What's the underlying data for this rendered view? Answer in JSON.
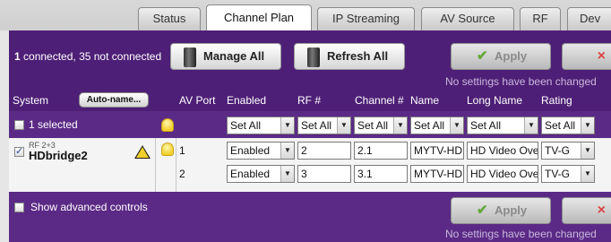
{
  "tabs": [
    {
      "label": "Status"
    },
    {
      "label": "Channel Plan",
      "active": true
    },
    {
      "label": "IP Streaming"
    },
    {
      "label": "AV Source"
    },
    {
      "label": "RF"
    },
    {
      "label": "Dev"
    }
  ],
  "toolbar": {
    "connected_count": "1",
    "connected_rest": " connected, 35 not connected",
    "manage_all": "Manage All",
    "refresh_all": "Refresh All",
    "apply": "Apply",
    "cancel_icon": "×",
    "status_note": "No settings have been changed"
  },
  "columns": {
    "system": "System",
    "auto_name": "Auto-name...",
    "av_port": "AV Port",
    "enabled": "Enabled",
    "rf": "RF #",
    "channel": "Channel #",
    "name": "Name",
    "long_name": "Long Name",
    "rating": "Rating"
  },
  "bulk_row": {
    "selected_label": "1 selected",
    "set_all": "Set All"
  },
  "device": {
    "sublabel": "RF 2+3",
    "name": "HDbridge2",
    "warning": "!",
    "ports": [
      {
        "port": "1",
        "enabled": "Enabled",
        "rf": "2",
        "channel": "2.1",
        "name": "MYTV-HD",
        "long_name": "HD Video Ove",
        "rating": "TV-G"
      },
      {
        "port": "2",
        "enabled": "Enabled",
        "rf": "3",
        "channel": "3.1",
        "name": "MYTV-HD",
        "long_name": "HD Video Ove",
        "rating": "TV-G"
      }
    ]
  },
  "footer": {
    "advanced_label": "Show advanced controls",
    "apply": "Apply",
    "cancel_icon": "×",
    "status_note": "No settings have been changed"
  },
  "icons": {
    "bulb": "lightbulb-icon",
    "warning": "warning-icon",
    "device": "device-icon",
    "check": "check-icon",
    "close": "close-icon"
  },
  "colors": {
    "panel": "#5b2a86",
    "header": "#4e1f76",
    "apply_check": "#64a83a",
    "cancel": "#d44444"
  }
}
